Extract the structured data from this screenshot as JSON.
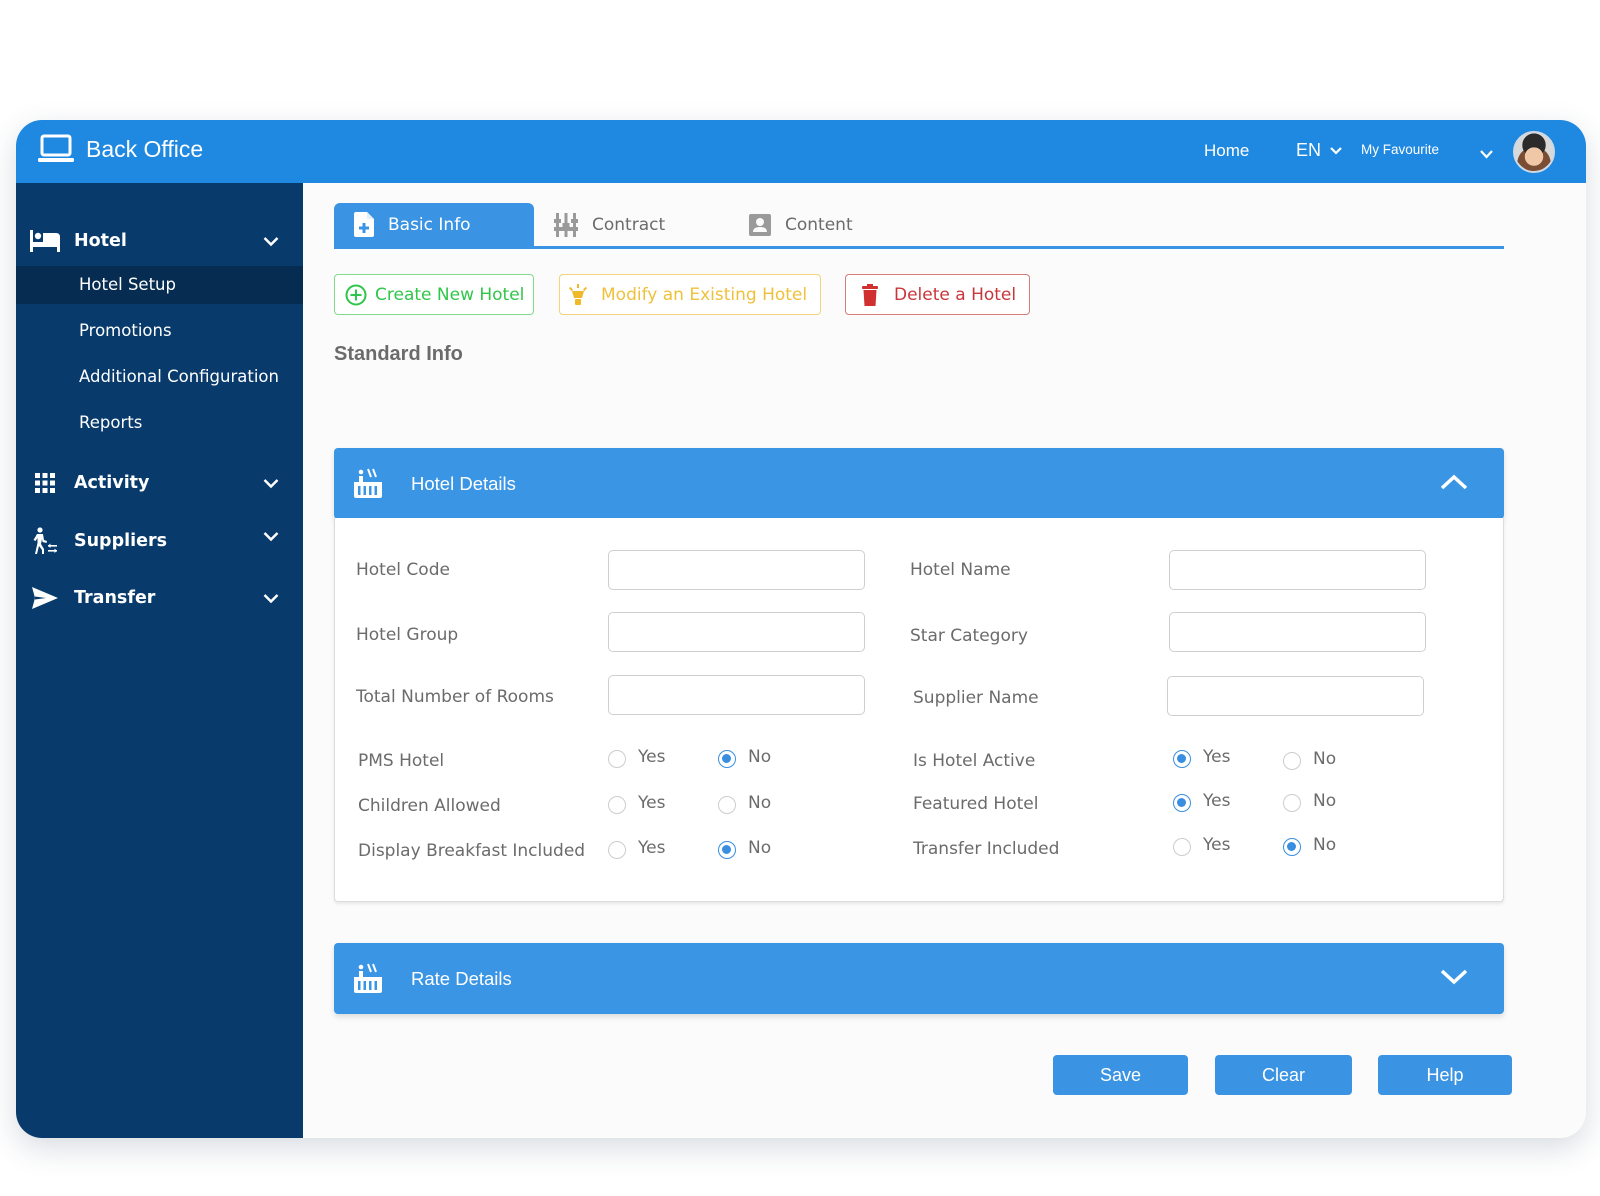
{
  "header": {
    "app_title": "Back Office",
    "home_label": "Home",
    "language": "EN",
    "favourite_label": "My Favourite"
  },
  "sidebar": {
    "groups": [
      {
        "label": "Hotel",
        "icon": "bed-icon",
        "expanded": true,
        "items": [
          {
            "label": "Hotel Setup",
            "active": true
          },
          {
            "label": "Promotions",
            "active": false
          },
          {
            "label": "Additional Configuration",
            "active": false
          },
          {
            "label": "Reports",
            "active": false
          }
        ]
      },
      {
        "label": "Activity",
        "icon": "grid-icon",
        "expanded": false
      },
      {
        "label": "Suppliers",
        "icon": "person-walking-icon",
        "expanded": false
      },
      {
        "label": "Transfer",
        "icon": "paper-plane-icon",
        "expanded": false
      }
    ]
  },
  "tabs": [
    {
      "label": "Basic Info",
      "icon": "file-plus-icon",
      "active": true
    },
    {
      "label": "Contract",
      "icon": "sliders-icon",
      "active": false
    },
    {
      "label": "Content",
      "icon": "user-card-icon",
      "active": false
    }
  ],
  "actions": {
    "create": "Create New Hotel",
    "modify": "Modify an Existing Hotel",
    "delete": "Delete a Hotel"
  },
  "section_title": "Standard Info",
  "hotel_details": {
    "title": "Hotel Details",
    "expanded": true,
    "fields": {
      "hotel_code": {
        "label": "Hotel Code",
        "value": ""
      },
      "hotel_name": {
        "label": "Hotel Name",
        "value": ""
      },
      "hotel_group": {
        "label": "Hotel Group",
        "value": ""
      },
      "star_category": {
        "label": "Star Category",
        "value": ""
      },
      "total_rooms": {
        "label": "Total Number of Rooms",
        "value": ""
      },
      "supplier_name": {
        "label": "Supplier Name",
        "value": ""
      }
    },
    "radio_yes": "Yes",
    "radio_no": "No",
    "options": {
      "pms_hotel": {
        "label": "PMS Hotel",
        "selected": "No"
      },
      "children_allowed": {
        "label": "Children Allowed",
        "selected": null
      },
      "display_breakfast": {
        "label": "Display Breakfast Included",
        "selected": "No"
      },
      "is_hotel_active": {
        "label": "Is Hotel Active",
        "selected": "Yes"
      },
      "featured_hotel": {
        "label": "Featured Hotel",
        "selected": "Yes"
      },
      "transfer_included": {
        "label": "Transfer Included",
        "selected": "No"
      }
    }
  },
  "rate_details": {
    "title": "Rate Details",
    "expanded": false
  },
  "footer": {
    "save": "Save",
    "clear": "Clear",
    "help": "Help"
  },
  "colors": {
    "topbar": "#1f88e0",
    "sidebar": "#083a6b",
    "sidebar_active": "#062c51",
    "accent": "#3a94e3",
    "create": "#2fc64a",
    "modify": "#efc13a",
    "delete": "#c8363a"
  }
}
